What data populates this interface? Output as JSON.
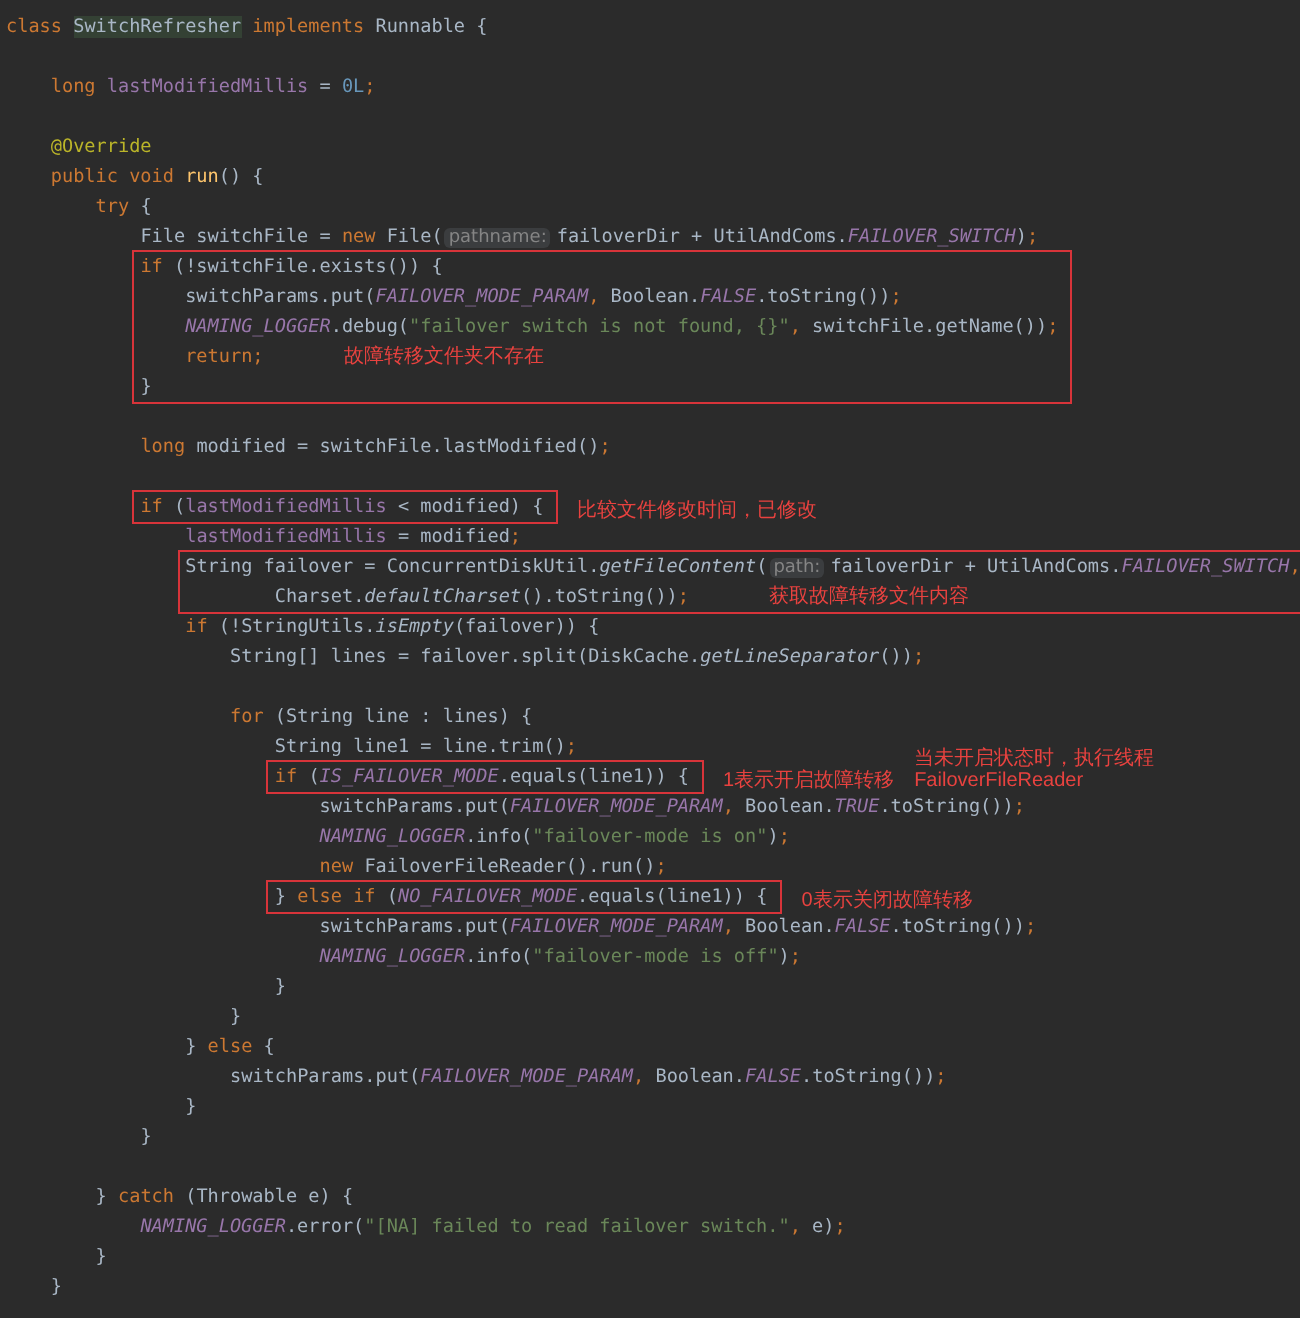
{
  "code": [
    {
      "kind": "lines",
      "lines": [
        {
          "kind": "code",
          "tokens": [
            {
              "kind": "k",
              "text": "class "
            },
            {
              "kind": "c",
              "text": "SwitchRefresher"
            },
            {
              "kind": "k",
              "text": " implements "
            },
            {
              "kind": "p",
              "text": "Runnable {"
            }
          ]
        },
        {
          "kind": "blank"
        },
        {
          "kind": "code",
          "tokens": [
            {
              "kind": "k",
              "text": "long "
            },
            {
              "kind": "f",
              "text": "lastModifiedMillis"
            },
            {
              "kind": "p",
              "text": " = "
            },
            {
              "kind": "n",
              "text": "0L"
            },
            {
              "kind": "k",
              "text": ";"
            }
          ]
        },
        {
          "kind": "blank"
        },
        {
          "kind": "code",
          "tokens": [
            {
              "kind": "a",
              "text": "@Override"
            }
          ]
        },
        {
          "kind": "code",
          "tokens": [
            {
              "kind": "k",
              "text": "public void "
            },
            {
              "kind": "d",
              "text": "run"
            },
            {
              "kind": "p",
              "text": "() {"
            }
          ]
        },
        {
          "kind": "code",
          "tokens": [
            {
              "kind": "k",
              "text": "try "
            },
            {
              "kind": "p",
              "text": "{"
            }
          ]
        },
        {
          "kind": "code",
          "tokens": [
            {
              "kind": "p",
              "text": "File switchFile = "
            },
            {
              "kind": "k",
              "text": "new "
            },
            {
              "kind": "p",
              "text": "File("
            },
            {
              "kind": "h",
              "text": "pathname:"
            },
            {
              "kind": "p",
              "text": "failoverDir + UtilAndComs."
            },
            {
              "kind": "s",
              "text": "FAILOVER_SWITCH"
            },
            {
              "kind": "p",
              "text": ")"
            },
            {
              "kind": "k",
              "text": ";"
            }
          ]
        }
      ]
    },
    {
      "kind": "boxed",
      "lines": [
        {
          "kind": "code",
          "tokens": [
            {
              "kind": "k",
              "text": "if "
            },
            {
              "kind": "p",
              "text": "(!switchFile.exists()) {"
            }
          ]
        },
        {
          "kind": "code",
          "tokens": [
            {
              "kind": "p",
              "text": "switchParams.put("
            },
            {
              "kind": "s",
              "text": "FAILOVER_MODE_PARAM"
            },
            {
              "kind": "k",
              "text": ", "
            },
            {
              "kind": "p",
              "text": "Boolean."
            },
            {
              "kind": "s",
              "text": "FALSE"
            },
            {
              "kind": "p",
              "text": ".toString())"
            },
            {
              "kind": "k",
              "text": ";"
            }
          ]
        },
        {
          "kind": "code",
          "tokens": [
            {
              "kind": "s",
              "text": "NAMING_LOGGER"
            },
            {
              "kind": "p",
              "text": ".debug("
            },
            {
              "kind": "t",
              "text": "\"failover switch is not found, {}\""
            },
            {
              "kind": "k",
              "text": ", "
            },
            {
              "kind": "p",
              "text": "switchFile.getName())"
            },
            {
              "kind": "k",
              "text": ";"
            }
          ]
        },
        {
          "kind": "code",
          "tokens": [
            {
              "kind": "k",
              "text": "return;"
            }
          ],
          "note": "故障转移文件夹不存在"
        },
        {
          "kind": "code",
          "tokens": [
            {
              "kind": "p",
              "text": "}"
            }
          ]
        }
      ]
    },
    {
      "kind": "lines",
      "lines": [
        {
          "kind": "blank"
        },
        {
          "kind": "code",
          "tokens": [
            {
              "kind": "k",
              "text": "long "
            },
            {
              "kind": "p",
              "text": "modified = switchFile.lastModified()"
            },
            {
              "kind": "k",
              "text": ";"
            }
          ]
        },
        {
          "kind": "blank"
        }
      ]
    },
    {
      "kind": "boxed",
      "notes": [
        "比较文件修改时间，已修改"
      ],
      "lines": [
        {
          "kind": "code",
          "tokens": [
            {
              "kind": "k",
              "text": "if "
            },
            {
              "kind": "p",
              "text": "("
            },
            {
              "kind": "f",
              "text": "lastModifiedMillis"
            },
            {
              "kind": "p",
              "text": " < modified) {"
            }
          ]
        }
      ]
    },
    {
      "kind": "lines",
      "lines": [
        {
          "kind": "code",
          "tokens": [
            {
              "kind": "f",
              "text": "lastModifiedMillis"
            },
            {
              "kind": "p",
              "text": " = modified"
            },
            {
              "kind": "k",
              "text": ";"
            }
          ]
        }
      ]
    },
    {
      "kind": "boxed",
      "lines": [
        {
          "kind": "code",
          "tokens": [
            {
              "kind": "p",
              "text": "String failover = ConcurrentDiskUtil."
            },
            {
              "kind": "m",
              "text": "getFileContent"
            },
            {
              "kind": "p",
              "text": "("
            },
            {
              "kind": "h",
              "text": "path:"
            },
            {
              "kind": "p",
              "text": "failoverDir + UtilAndComs."
            },
            {
              "kind": "s",
              "text": "FAILOVER_SWITCH"
            },
            {
              "kind": "k",
              "text": ","
            }
          ]
        },
        {
          "kind": "code",
          "continuation": true,
          "tokens": [
            {
              "kind": "p",
              "text": "Charset."
            },
            {
              "kind": "m",
              "text": "defaultCharset"
            },
            {
              "kind": "p",
              "text": "().toString())"
            },
            {
              "kind": "k",
              "text": ";"
            }
          ],
          "note": "获取故障转移文件内容"
        }
      ]
    },
    {
      "kind": "lines",
      "lines": [
        {
          "kind": "code",
          "tokens": [
            {
              "kind": "k",
              "text": "if "
            },
            {
              "kind": "p",
              "text": "(!StringUtils."
            },
            {
              "kind": "m",
              "text": "isEmpty"
            },
            {
              "kind": "p",
              "text": "(failover)) {"
            }
          ]
        },
        {
          "kind": "code",
          "tokens": [
            {
              "kind": "p",
              "text": "String[] lines = failover.split(DiskCache."
            },
            {
              "kind": "m",
              "text": "getLineSeparator"
            },
            {
              "kind": "p",
              "text": "())"
            },
            {
              "kind": "k",
              "text": ";"
            }
          ]
        },
        {
          "kind": "blank"
        },
        {
          "kind": "code",
          "tokens": [
            {
              "kind": "k",
              "text": "for "
            },
            {
              "kind": "p",
              "text": "(String line : lines) {"
            }
          ]
        },
        {
          "kind": "code",
          "tokens": [
            {
              "kind": "p",
              "text": "String line1 = line.trim()"
            },
            {
              "kind": "k",
              "text": ";"
            }
          ]
        }
      ]
    },
    {
      "kind": "boxed",
      "notes": [
        "1表示开启故障转移",
        "当未开启状态时，执行线程FailoverFileReader"
      ],
      "lines": [
        {
          "kind": "code",
          "tokens": [
            {
              "kind": "k",
              "text": "if "
            },
            {
              "kind": "p",
              "text": "("
            },
            {
              "kind": "s",
              "text": "IS_FAILOVER_MODE"
            },
            {
              "kind": "p",
              "text": ".equals(line1)) {"
            }
          ]
        }
      ]
    },
    {
      "kind": "lines",
      "lines": [
        {
          "kind": "code",
          "tokens": [
            {
              "kind": "p",
              "text": "switchParams.put("
            },
            {
              "kind": "s",
              "text": "FAILOVER_MODE_PARAM"
            },
            {
              "kind": "k",
              "text": ", "
            },
            {
              "kind": "p",
              "text": "Boolean."
            },
            {
              "kind": "s",
              "text": "TRUE"
            },
            {
              "kind": "p",
              "text": ".toString())"
            },
            {
              "kind": "k",
              "text": ";"
            }
          ]
        },
        {
          "kind": "code",
          "tokens": [
            {
              "kind": "s",
              "text": "NAMING_LOGGER"
            },
            {
              "kind": "p",
              "text": ".info("
            },
            {
              "kind": "t",
              "text": "\"failover-mode is on\""
            },
            {
              "kind": "p",
              "text": ")"
            },
            {
              "kind": "k",
              "text": ";"
            }
          ]
        },
        {
          "kind": "code",
          "tokens": [
            {
              "kind": "k",
              "text": "new "
            },
            {
              "kind": "p",
              "text": "FailoverFileReader().run()"
            },
            {
              "kind": "k",
              "text": ";"
            }
          ]
        }
      ]
    },
    {
      "kind": "boxed",
      "notes": [
        "0表示关闭故障转移"
      ],
      "lines": [
        {
          "kind": "code",
          "tokens": [
            {
              "kind": "p",
              "text": "} "
            },
            {
              "kind": "k",
              "text": "else if "
            },
            {
              "kind": "p",
              "text": "("
            },
            {
              "kind": "s",
              "text": "NO_FAILOVER_MODE"
            },
            {
              "kind": "p",
              "text": ".equals(line1)) {"
            }
          ]
        }
      ]
    },
    {
      "kind": "lines",
      "lines": [
        {
          "kind": "code",
          "tokens": [
            {
              "kind": "p",
              "text": "switchParams.put("
            },
            {
              "kind": "s",
              "text": "FAILOVER_MODE_PARAM"
            },
            {
              "kind": "k",
              "text": ", "
            },
            {
              "kind": "p",
              "text": "Boolean."
            },
            {
              "kind": "s",
              "text": "FALSE"
            },
            {
              "kind": "p",
              "text": ".toString())"
            },
            {
              "kind": "k",
              "text": ";"
            }
          ]
        },
        {
          "kind": "code",
          "tokens": [
            {
              "kind": "s",
              "text": "NAMING_LOGGER"
            },
            {
              "kind": "p",
              "text": ".info("
            },
            {
              "kind": "t",
              "text": "\"failover-mode is off\""
            },
            {
              "kind": "p",
              "text": ")"
            },
            {
              "kind": "k",
              "text": ";"
            }
          ]
        },
        {
          "kind": "code",
          "tokens": [
            {
              "kind": "p",
              "text": "}"
            }
          ]
        },
        {
          "kind": "code",
          "tokens": [
            {
              "kind": "p",
              "text": "}"
            }
          ]
        },
        {
          "kind": "code",
          "tokens": [
            {
              "kind": "p",
              "text": "} "
            },
            {
              "kind": "k",
              "text": "else "
            },
            {
              "kind": "p",
              "text": "{"
            }
          ]
        },
        {
          "kind": "code",
          "tokens": [
            {
              "kind": "p",
              "text": "switchParams.put("
            },
            {
              "kind": "s",
              "text": "FAILOVER_MODE_PARAM"
            },
            {
              "kind": "k",
              "text": ", "
            },
            {
              "kind": "p",
              "text": "Boolean."
            },
            {
              "kind": "s",
              "text": "FALSE"
            },
            {
              "kind": "p",
              "text": ".toString())"
            },
            {
              "kind": "k",
              "text": ";"
            }
          ]
        },
        {
          "kind": "code",
          "tokens": [
            {
              "kind": "p",
              "text": "}"
            }
          ]
        },
        {
          "kind": "code",
          "tokens": [
            {
              "kind": "p",
              "text": "}"
            }
          ]
        },
        {
          "kind": "blank"
        },
        {
          "kind": "code",
          "tokens": [
            {
              "kind": "p",
              "text": "} "
            },
            {
              "kind": "k",
              "text": "catch "
            },
            {
              "kind": "p",
              "text": "(Throwable e) {"
            }
          ]
        },
        {
          "kind": "code",
          "tokens": [
            {
              "kind": "s",
              "text": "NAMING_LOGGER"
            },
            {
              "kind": "p",
              "text": ".error("
            },
            {
              "kind": "t",
              "text": "\"[NA] failed to read failover switch.\""
            },
            {
              "kind": "k",
              "text": ", "
            },
            {
              "kind": "p",
              "text": "e)"
            },
            {
              "kind": "k",
              "text": ";"
            }
          ]
        },
        {
          "kind": "code",
          "tokens": [
            {
              "kind": "p",
              "text": "}"
            }
          ]
        },
        {
          "kind": "code",
          "tokens": [
            {
              "kind": "p",
              "text": "}"
            }
          ]
        }
      ]
    }
  ]
}
